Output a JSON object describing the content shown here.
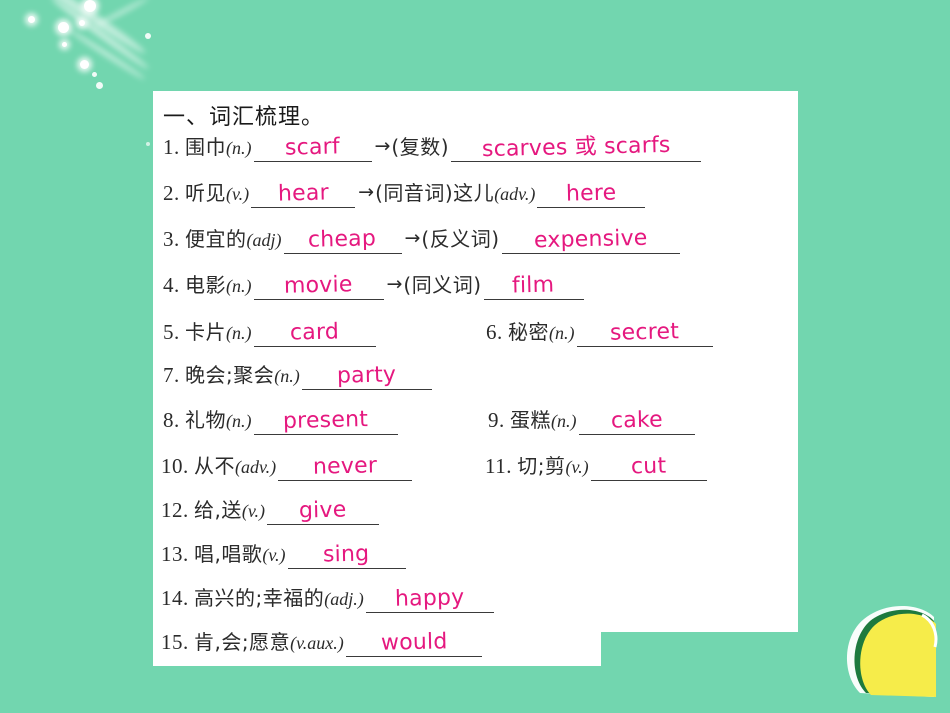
{
  "theme": {
    "background_color": "#72d6af",
    "panel_color": "#ffffff",
    "answer_color": "#e5187f",
    "text_color": "#2b2b2b",
    "rule_color": "#3a3a3a",
    "leaf_color": "#f6ec4a",
    "leaf_outline_color": "#1d7a3e"
  },
  "worksheet": {
    "section_title": "一、词汇梳理。",
    "arrow_glyph": "→",
    "items": [
      {
        "number": "1.",
        "prompt_cn": "围巾",
        "pos": "(n.)",
        "answer": "scarf",
        "arrow": "→",
        "relation_cn": "(复数)",
        "answer2": "scarves 或 scarfs"
      },
      {
        "number": "2.",
        "prompt_cn": "听见",
        "pos": "(v.)",
        "answer": "hear",
        "arrow": "→",
        "relation_cn": "(同音词)这儿",
        "pos2": "(adv.)",
        "answer2": "here"
      },
      {
        "number": "3.",
        "prompt_cn": "便宜的",
        "pos": "(adj)",
        "answer": "cheap",
        "arrow": "→",
        "relation_cn": "(反义词)",
        "answer2": "expensive"
      },
      {
        "number": "4.",
        "prompt_cn": "电影",
        "pos": "(n.)",
        "answer": "movie",
        "arrow": "→",
        "relation_cn": "(同义词)",
        "answer2": "film"
      },
      {
        "number": "5.",
        "prompt_cn": "卡片",
        "pos": "(n.)",
        "answer": "card"
      },
      {
        "number": "6.",
        "prompt_cn": "秘密",
        "pos": "(n.)",
        "answer": "secret"
      },
      {
        "number": "7.",
        "prompt_cn": "晚会;聚会",
        "pos": "(n.)",
        "answer": "party"
      },
      {
        "number": "8.",
        "prompt_cn": "礼物",
        "pos": "(n.)",
        "answer": "present"
      },
      {
        "number": "9.",
        "prompt_cn": "蛋糕",
        "pos": "(n.)",
        "answer": "cake"
      },
      {
        "number": "10.",
        "prompt_cn": "从不",
        "pos": "(adv.)",
        "answer": "never"
      },
      {
        "number": "11.",
        "prompt_cn": "切;剪",
        "pos": "(v.)",
        "answer": "cut"
      },
      {
        "number": "12.",
        "prompt_cn": "给,送",
        "pos": "(v.)",
        "answer": "give"
      },
      {
        "number": "13.",
        "prompt_cn": "唱,唱歌",
        "pos": "(v.)",
        "answer": "sing"
      },
      {
        "number": "14.",
        "prompt_cn": "高兴的;幸福的",
        "pos": "(adj.)",
        "answer": "happy"
      },
      {
        "number": "15.",
        "prompt_cn": "肯,会;愿意",
        "pos": "(v.aux.)",
        "answer": "would"
      }
    ]
  }
}
